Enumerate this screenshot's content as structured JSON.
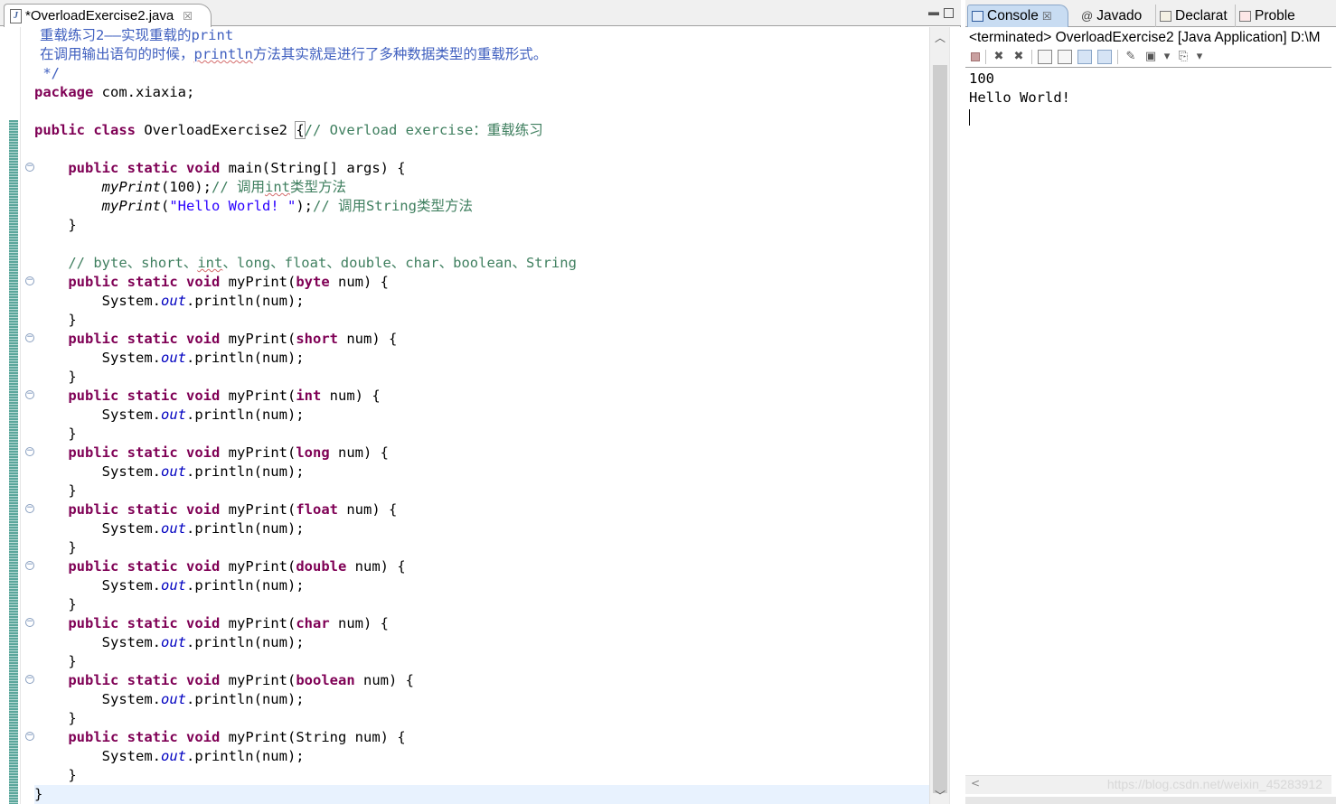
{
  "editor": {
    "tab_title": "*OverloadExercise2.java",
    "tab_close_icon": "close-icon",
    "file_icon": "java-file-icon",
    "code": {
      "doc_line1": "重载练习2——实现重载的print",
      "doc_line2_pre": "在调用输出语句的时候，",
      "doc_line2_word": "println",
      "doc_line2_post": "方法其实就是进行了多种数据类型的重载形式。",
      "doc_end": " */",
      "kw_package": "package",
      "package_name": " com.xiaxia;",
      "kw_public": "public",
      "kw_class": "class",
      "class_name": " OverloadExercise2 ",
      "open_brace": "{",
      "class_comment": "// Overload exercise：重载练习",
      "kw_static": "static",
      "kw_void": "void",
      "main_sig": " main(String[] args) {",
      "call_name": "myPrint",
      "call1_args": "(100);",
      "call1_comment_pre": "// 调用",
      "call1_comment_word": "int",
      "call1_comment_post": "类型方法",
      "call2_open": "(",
      "call2_string": "\"Hello World! \"",
      "call2_close": ");",
      "call2_comment": "// 调用String类型方法",
      "close_brace": "}",
      "types_comment_pre": "// byte、short、",
      "types_comment_word": "int",
      "types_comment_post": "、long、float、double、char、boolean、String",
      "method_name": " myPrint(",
      "param_tail": " num) {",
      "body_sys": "System.",
      "body_out": "out",
      "body_call": ".println(num);",
      "overloads": [
        {
          "type": "byte"
        },
        {
          "type": "short"
        },
        {
          "type": "int"
        },
        {
          "type": "long"
        },
        {
          "type": "float"
        },
        {
          "type": "double"
        },
        {
          "type": "char"
        },
        {
          "type": "boolean"
        },
        {
          "type": "String"
        }
      ]
    }
  },
  "console_view": {
    "tabs": [
      {
        "label": "Console",
        "icon": "console-icon",
        "active": true
      },
      {
        "label": "Javado",
        "icon": "at-icon"
      },
      {
        "label": "Declarat",
        "icon": "declaration-icon"
      },
      {
        "label": "Proble",
        "icon": "problems-icon"
      }
    ],
    "close_glyph": "☒",
    "header": "<terminated> OverloadExercise2 [Java Application] D:\\M",
    "output": [
      "100",
      "Hello World! "
    ],
    "watermark": "https://blog.csdn.net/weixin_45283912"
  },
  "colors": {
    "keyword": "#7f0055",
    "comment": "#3f7f5f",
    "javadoc": "#3f5fbf",
    "string": "#2a00ff",
    "field": "#0000c0",
    "change_bar": "#5aa69b",
    "active_tab": "#c8dcf2"
  }
}
